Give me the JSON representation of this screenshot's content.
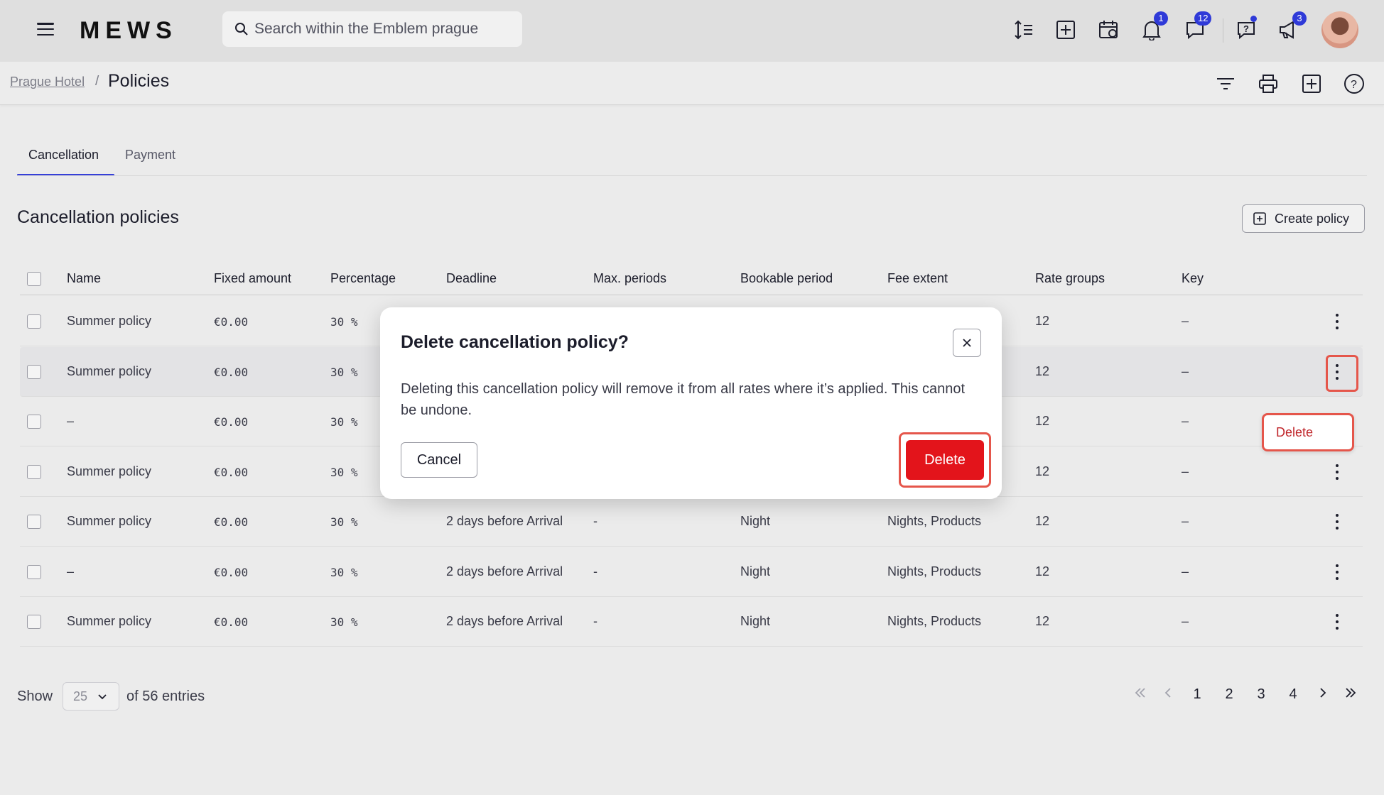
{
  "app": {
    "logo": "MEWS"
  },
  "search": {
    "placeholder": "Search within the Emblem prague"
  },
  "topbar": {
    "notifications_badge": "1",
    "messages_badge": "12",
    "announcements_badge": "3"
  },
  "breadcrumb": {
    "parent": "Prague Hotel",
    "separator": "/",
    "current": "Policies"
  },
  "tabs": [
    {
      "label": "Cancellation"
    },
    {
      "label": "Payment"
    }
  ],
  "section": {
    "title": "Cancellation policies",
    "create_label": "Create policy"
  },
  "table": {
    "columns": [
      "Name",
      "Fixed amount",
      "Percentage",
      "Deadline",
      "Max. periods",
      "Bookable period",
      "Fee extent",
      "Rate groups",
      "Key"
    ],
    "rows": [
      {
        "name": "Summer policy",
        "fixed": "€0.00",
        "pct": "30 %",
        "deadline": "",
        "max": "",
        "bookable": "",
        "fee": "",
        "rate": "12",
        "key": "–"
      },
      {
        "name": "Summer policy",
        "fixed": "€0.00",
        "pct": "30 %",
        "deadline": "",
        "max": "",
        "bookable": "",
        "fee": "",
        "rate": "12",
        "key": "–"
      },
      {
        "name": "–",
        "fixed": "€0.00",
        "pct": "30 %",
        "deadline": "",
        "max": "",
        "bookable": "",
        "fee": "",
        "rate": "12",
        "key": "–"
      },
      {
        "name": "Summer policy",
        "fixed": "€0.00",
        "pct": "30 %",
        "deadline": "",
        "max": "",
        "bookable": "",
        "fee": "",
        "rate": "12",
        "key": "–"
      },
      {
        "name": "Summer policy",
        "fixed": "€0.00",
        "pct": "30 %",
        "deadline": "2 days before Arrival",
        "max": "-",
        "bookable": "Night",
        "fee": "Nights, Products",
        "rate": "12",
        "key": "–"
      },
      {
        "name": "–",
        "fixed": "€0.00",
        "pct": "30 %",
        "deadline": "2 days before Arrival",
        "max": "-",
        "bookable": "Night",
        "fee": "Nights, Products",
        "rate": "12",
        "key": "–"
      },
      {
        "name": "Summer policy",
        "fixed": "€0.00",
        "pct": "30 %",
        "deadline": "2 days before Arrival",
        "max": "-",
        "bookable": "Night",
        "fee": "Nights, Products",
        "rate": "12",
        "key": "–"
      }
    ]
  },
  "context_menu": {
    "delete_label": "Delete"
  },
  "footer": {
    "show_label": "Show",
    "page_size": "25",
    "entries_label": "of 56 entries",
    "pages": [
      "1",
      "2",
      "3",
      "4"
    ]
  },
  "modal": {
    "title": "Delete cancellation policy?",
    "body": "Deleting this cancellation policy will remove it from all rates where it’s applied. This cannot be undone.",
    "cancel_label": "Cancel",
    "delete_label": "Delete"
  },
  "colors": {
    "accent": "#3640d8",
    "danger": "#e3141b",
    "highlight": "#e5564b",
    "badge": "#2f3ad8"
  }
}
